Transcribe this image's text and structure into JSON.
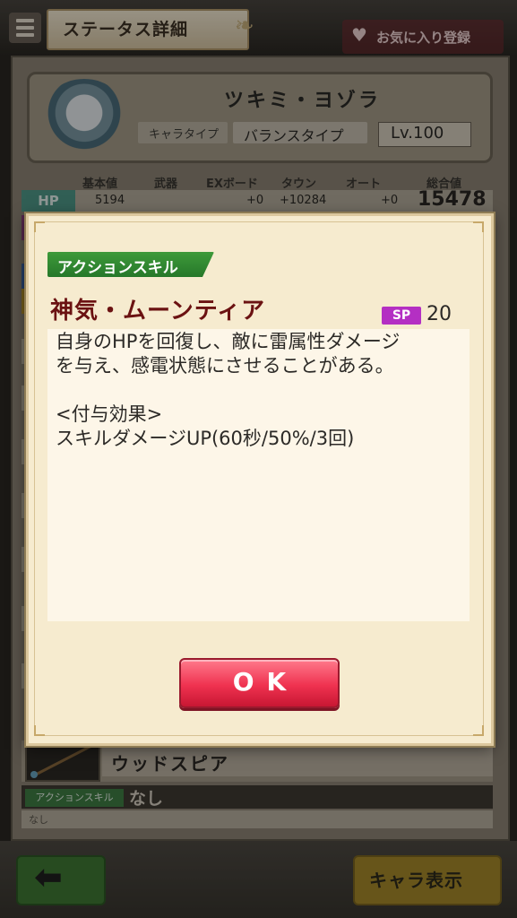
{
  "header": {
    "title": "ステータス詳細",
    "favorite_label": "お気に入り登録"
  },
  "character": {
    "name": "ツキミ・ヨゾラ",
    "type_label": "キャラタイプ",
    "type_value": "バランスタイプ",
    "level": "Lv.100"
  },
  "stats": {
    "columns": [
      "基本値",
      "武器",
      "EXボード",
      "タウン",
      "オート",
      "総合値"
    ],
    "hp": {
      "label": "HP",
      "base": "5194",
      "weapon": "",
      "exboard": "+0",
      "town": "+10284",
      "auto": "+0",
      "total": "15478"
    }
  },
  "weapon": {
    "name": "ウッドスピア",
    "action_skill_tag": "アクションスキル",
    "action_skill_value": "なし",
    "action_skill_desc": "なし"
  },
  "modal": {
    "tag": "アクションスキル",
    "skill_name": "神気・ムーンティア",
    "sp_label": "SP",
    "sp_value": "20",
    "description": "自身のHPを回復し、敵に雷属性ダメージ\nを与え、感電状態にさせることがある。\n\n<付与効果>\nスキルダメージUP(60秒/50%/3回)",
    "ok_label": "OK"
  },
  "footer": {
    "chara_button": "キャラ表示"
  },
  "colors": {
    "modal_bg": "#f6ebcf",
    "skill_tag_green": "#2f8a30",
    "skill_name_red": "#6b1212",
    "sp_purple": "#b42fc3",
    "ok_red": "#ef3250"
  },
  "icons": {
    "menu": "hamburger-icon",
    "favorite": "heart-icon",
    "back": "left-arrow-icon"
  }
}
